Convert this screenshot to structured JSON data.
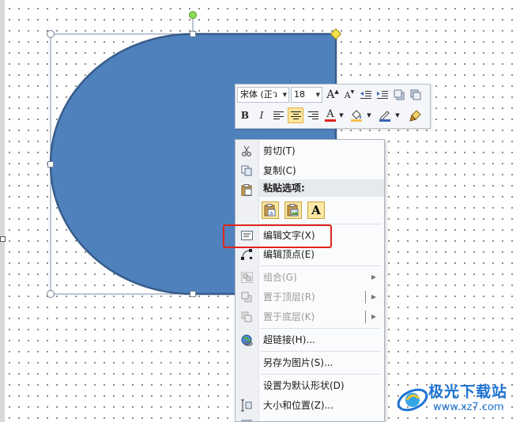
{
  "shape": {
    "fill": "#4f81bd",
    "stroke": "#385d8a"
  },
  "mini_toolbar": {
    "font_name": "宋体 (正ว",
    "font_size": "18",
    "grow_font": "A",
    "shrink_font": "A",
    "bold": "B",
    "italic": "I",
    "font_color_glyph": "A"
  },
  "context_menu": {
    "items": [
      {
        "label": "剪切(T)",
        "icon": "scissors-icon",
        "enabled": true
      },
      {
        "label": "复制(C)",
        "icon": "copy-icon",
        "enabled": true
      },
      {
        "label": "编辑文字(X)",
        "icon": "edit-text-icon",
        "enabled": true
      },
      {
        "label": "编辑顶点(E)",
        "icon": "edit-points-icon",
        "enabled": true
      },
      {
        "label": "组合(G)",
        "icon": "group-icon",
        "enabled": false
      },
      {
        "label": "置于顶层(R)",
        "icon": "bring-to-front-icon",
        "enabled": false
      },
      {
        "label": "置于底层(K)",
        "icon": "send-to-back-icon",
        "enabled": false
      },
      {
        "label": "超链接(H)...",
        "icon": "hyperlink-icon",
        "enabled": true
      },
      {
        "label": "另存为图片(S)...",
        "icon": "",
        "enabled": true
      },
      {
        "label": "设置为默认形状(D)",
        "icon": "",
        "enabled": true
      },
      {
        "label": "大小和位置(Z)...",
        "icon": "size-position-icon",
        "enabled": true
      }
    ],
    "paste_options_label": "粘贴选项:",
    "paste_text_only": "A"
  },
  "watermark": {
    "title": "极光下载站",
    "url": "www.xz7.com"
  },
  "colors": {
    "highlight": "#e0241b",
    "accent": "#1e73d2",
    "font_color": "#e02020"
  }
}
